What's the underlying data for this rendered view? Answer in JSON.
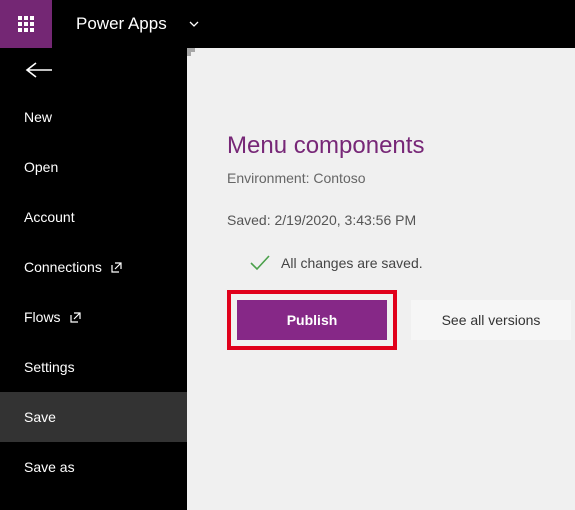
{
  "header": {
    "app_title": "Power Apps"
  },
  "sidebar": {
    "items": [
      {
        "label": "New"
      },
      {
        "label": "Open"
      },
      {
        "label": "Account"
      },
      {
        "label": "Connections"
      },
      {
        "label": "Flows"
      },
      {
        "label": "Settings"
      },
      {
        "label": "Save"
      },
      {
        "label": "Save as"
      }
    ]
  },
  "main": {
    "page_title": "Menu components",
    "environment_label": "Environment: Contoso",
    "saved_text": "Saved: 2/19/2020, 3:43:56 PM",
    "status_text": "All changes are saved.",
    "publish_label": "Publish",
    "see_versions_label": "See all versions"
  }
}
